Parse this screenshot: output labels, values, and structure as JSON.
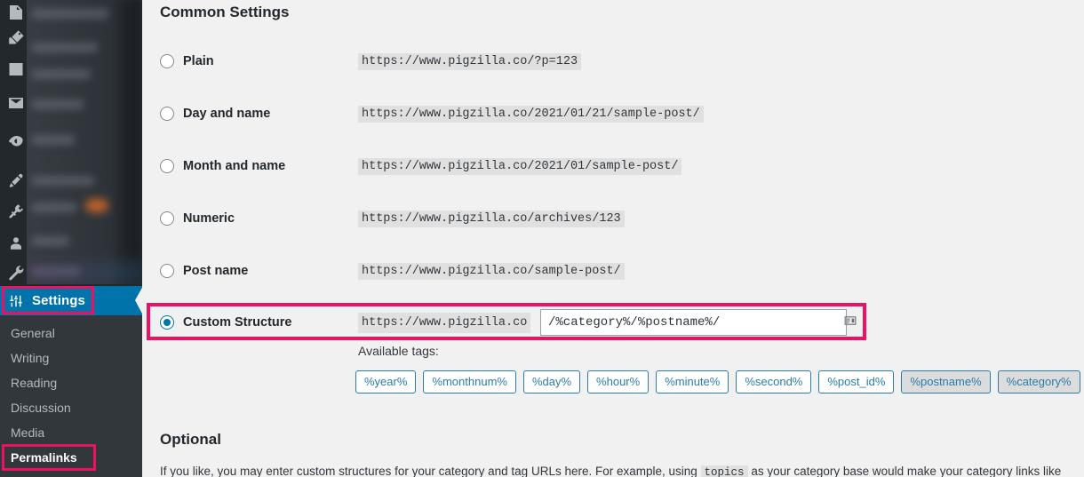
{
  "sidebar": {
    "icons": [
      {
        "name": "posts-icon"
      },
      {
        "name": "media-icon"
      },
      {
        "name": "pages-icon"
      },
      {
        "name": "mail-icon"
      },
      {
        "name": "seo-icon"
      },
      {
        "name": "appearance-icon"
      },
      {
        "name": "plugins-icon"
      },
      {
        "name": "users-icon"
      },
      {
        "name": "tools-icon"
      }
    ],
    "settings": {
      "label": "Settings",
      "icon": "settings-sliders-icon"
    },
    "submenu": [
      {
        "label": "General",
        "current": false
      },
      {
        "label": "Writing",
        "current": false
      },
      {
        "label": "Reading",
        "current": false
      },
      {
        "label": "Discussion",
        "current": false
      },
      {
        "label": "Media",
        "current": false
      },
      {
        "label": "Permalinks",
        "current": true
      }
    ]
  },
  "main": {
    "common_settings_title": "Common Settings",
    "optional_title": "Optional",
    "options": [
      {
        "label": "Plain",
        "url": "https://www.pigzilla.co/?p=123",
        "selected": false
      },
      {
        "label": "Day and name",
        "url": "https://www.pigzilla.co/2021/01/21/sample-post/",
        "selected": false
      },
      {
        "label": "Month and name",
        "url": "https://www.pigzilla.co/2021/01/sample-post/",
        "selected": false
      },
      {
        "label": "Numeric",
        "url": "https://www.pigzilla.co/archives/123",
        "selected": false
      },
      {
        "label": "Post name",
        "url": "https://www.pigzilla.co/sample-post/",
        "selected": false
      }
    ],
    "custom_structure": {
      "label": "Custom Structure",
      "selected": true,
      "prefix": "https://www.pigzilla.co",
      "value": "/%category%/%postname%/",
      "autofill_icon": "contact-card-icon"
    },
    "available_tags_label": "Available tags:",
    "tags": [
      {
        "label": "%year%",
        "used": false
      },
      {
        "label": "%monthnum%",
        "used": false
      },
      {
        "label": "%day%",
        "used": false
      },
      {
        "label": "%hour%",
        "used": false
      },
      {
        "label": "%minute%",
        "used": false
      },
      {
        "label": "%second%",
        "used": false
      },
      {
        "label": "%post_id%",
        "used": false
      },
      {
        "label": "%postname%",
        "used": true
      },
      {
        "label": "%category%",
        "used": true
      }
    ],
    "optional_text_before": "If you like, you may enter custom structures for your category and tag URLs here. For example, using",
    "optional_code": "topics",
    "optional_text_after": "as your category base would make your category links like"
  },
  "colors": {
    "highlight_pink": "#eb1266",
    "wp_blue": "#0073aa",
    "sidebar_dark": "#23282d",
    "submenu_dark": "#32373c",
    "content_bg": "#f1f1f1"
  }
}
